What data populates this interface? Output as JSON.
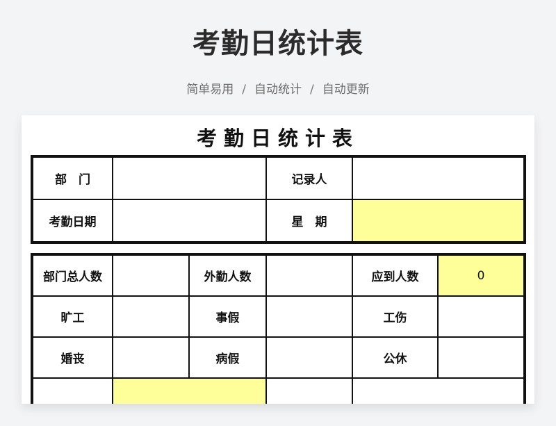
{
  "hero": {
    "title": "考勤日统计表",
    "features": [
      "简单易用",
      "自动统计",
      "自动更新"
    ],
    "separator": "/"
  },
  "sheet": {
    "title": "考勤日统计表",
    "header_table": {
      "rows": [
        {
          "label1": "部　门",
          "value1": "",
          "label2": "记录人",
          "value2": ""
        },
        {
          "label1": "考勤日期",
          "value1": "",
          "label2": "星　期",
          "value2": ""
        }
      ]
    },
    "stats_table": {
      "rows": [
        {
          "l1": "部门总人数",
          "v1": "",
          "l2": "外勤人数",
          "v2": "",
          "l3": "应到人数",
          "v3": "0"
        },
        {
          "l1": "旷工",
          "v1": "",
          "l2": "事假",
          "v2": "",
          "l3": "工伤",
          "v3": ""
        },
        {
          "l1": "婚丧",
          "v1": "",
          "l2": "病假",
          "v2": "",
          "l3": "公休",
          "v3": ""
        },
        {
          "l1": "",
          "v1": "",
          "l2": "",
          "v2": "",
          "l3": "",
          "v3": ""
        }
      ]
    },
    "highlight_color": "#ffff99"
  }
}
